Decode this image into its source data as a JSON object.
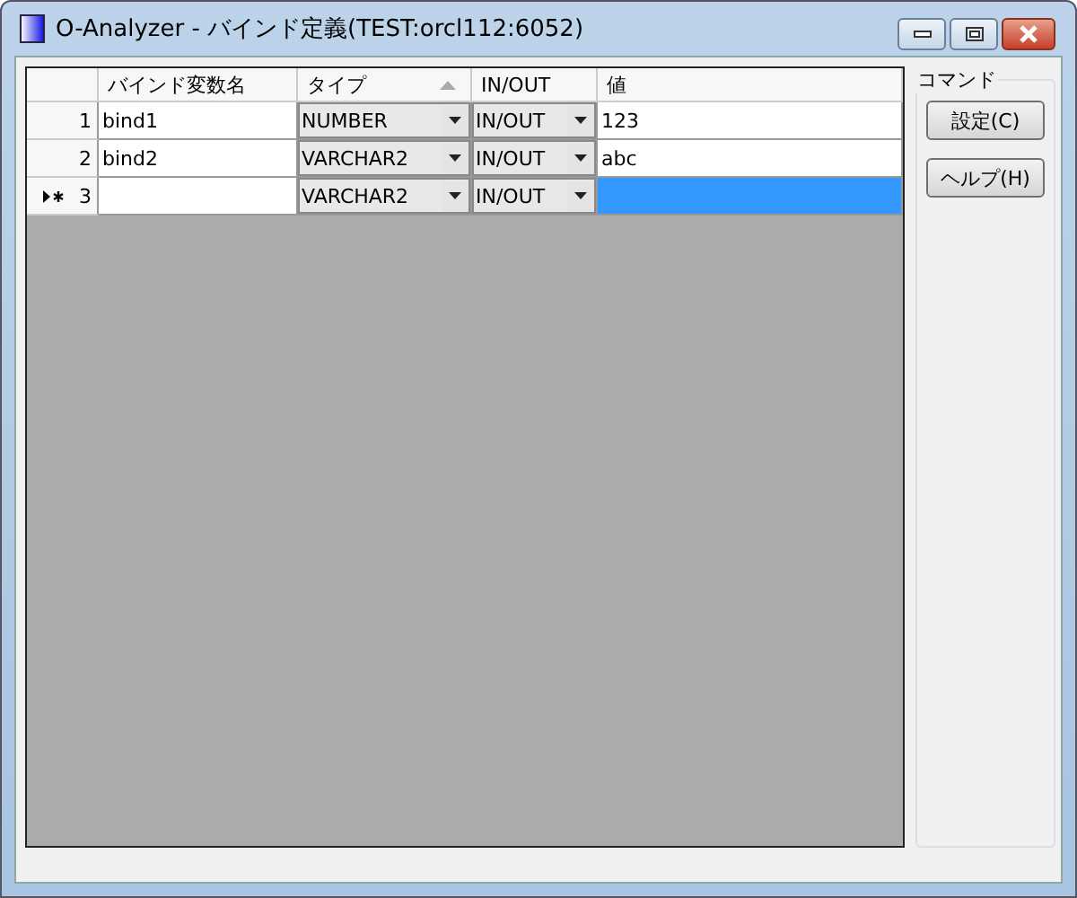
{
  "window": {
    "title": "O-Analyzer - バインド定義(TEST:orcl112:6052)"
  },
  "grid": {
    "columns": [
      {
        "label": "バインド変数名",
        "sorted": false
      },
      {
        "label": "タイプ",
        "sorted": true
      },
      {
        "label": "IN/OUT",
        "sorted": false
      },
      {
        "label": "値",
        "sorted": false
      }
    ],
    "rows": [
      {
        "number": "1",
        "name": "bind1",
        "type": "NUMBER",
        "inout": "IN/OUT",
        "value": "123",
        "current": false,
        "selected": false
      },
      {
        "number": "2",
        "name": "bind2",
        "type": "VARCHAR2",
        "inout": "IN/OUT",
        "value": "abc",
        "current": false,
        "selected": false
      },
      {
        "number": "3",
        "name": "",
        "type": "VARCHAR2",
        "inout": "IN/OUT",
        "value": "",
        "current": true,
        "selected": true
      }
    ]
  },
  "command_group": {
    "title": "コマンド",
    "buttons": [
      "設定(C)",
      "ヘルプ(H)"
    ]
  }
}
